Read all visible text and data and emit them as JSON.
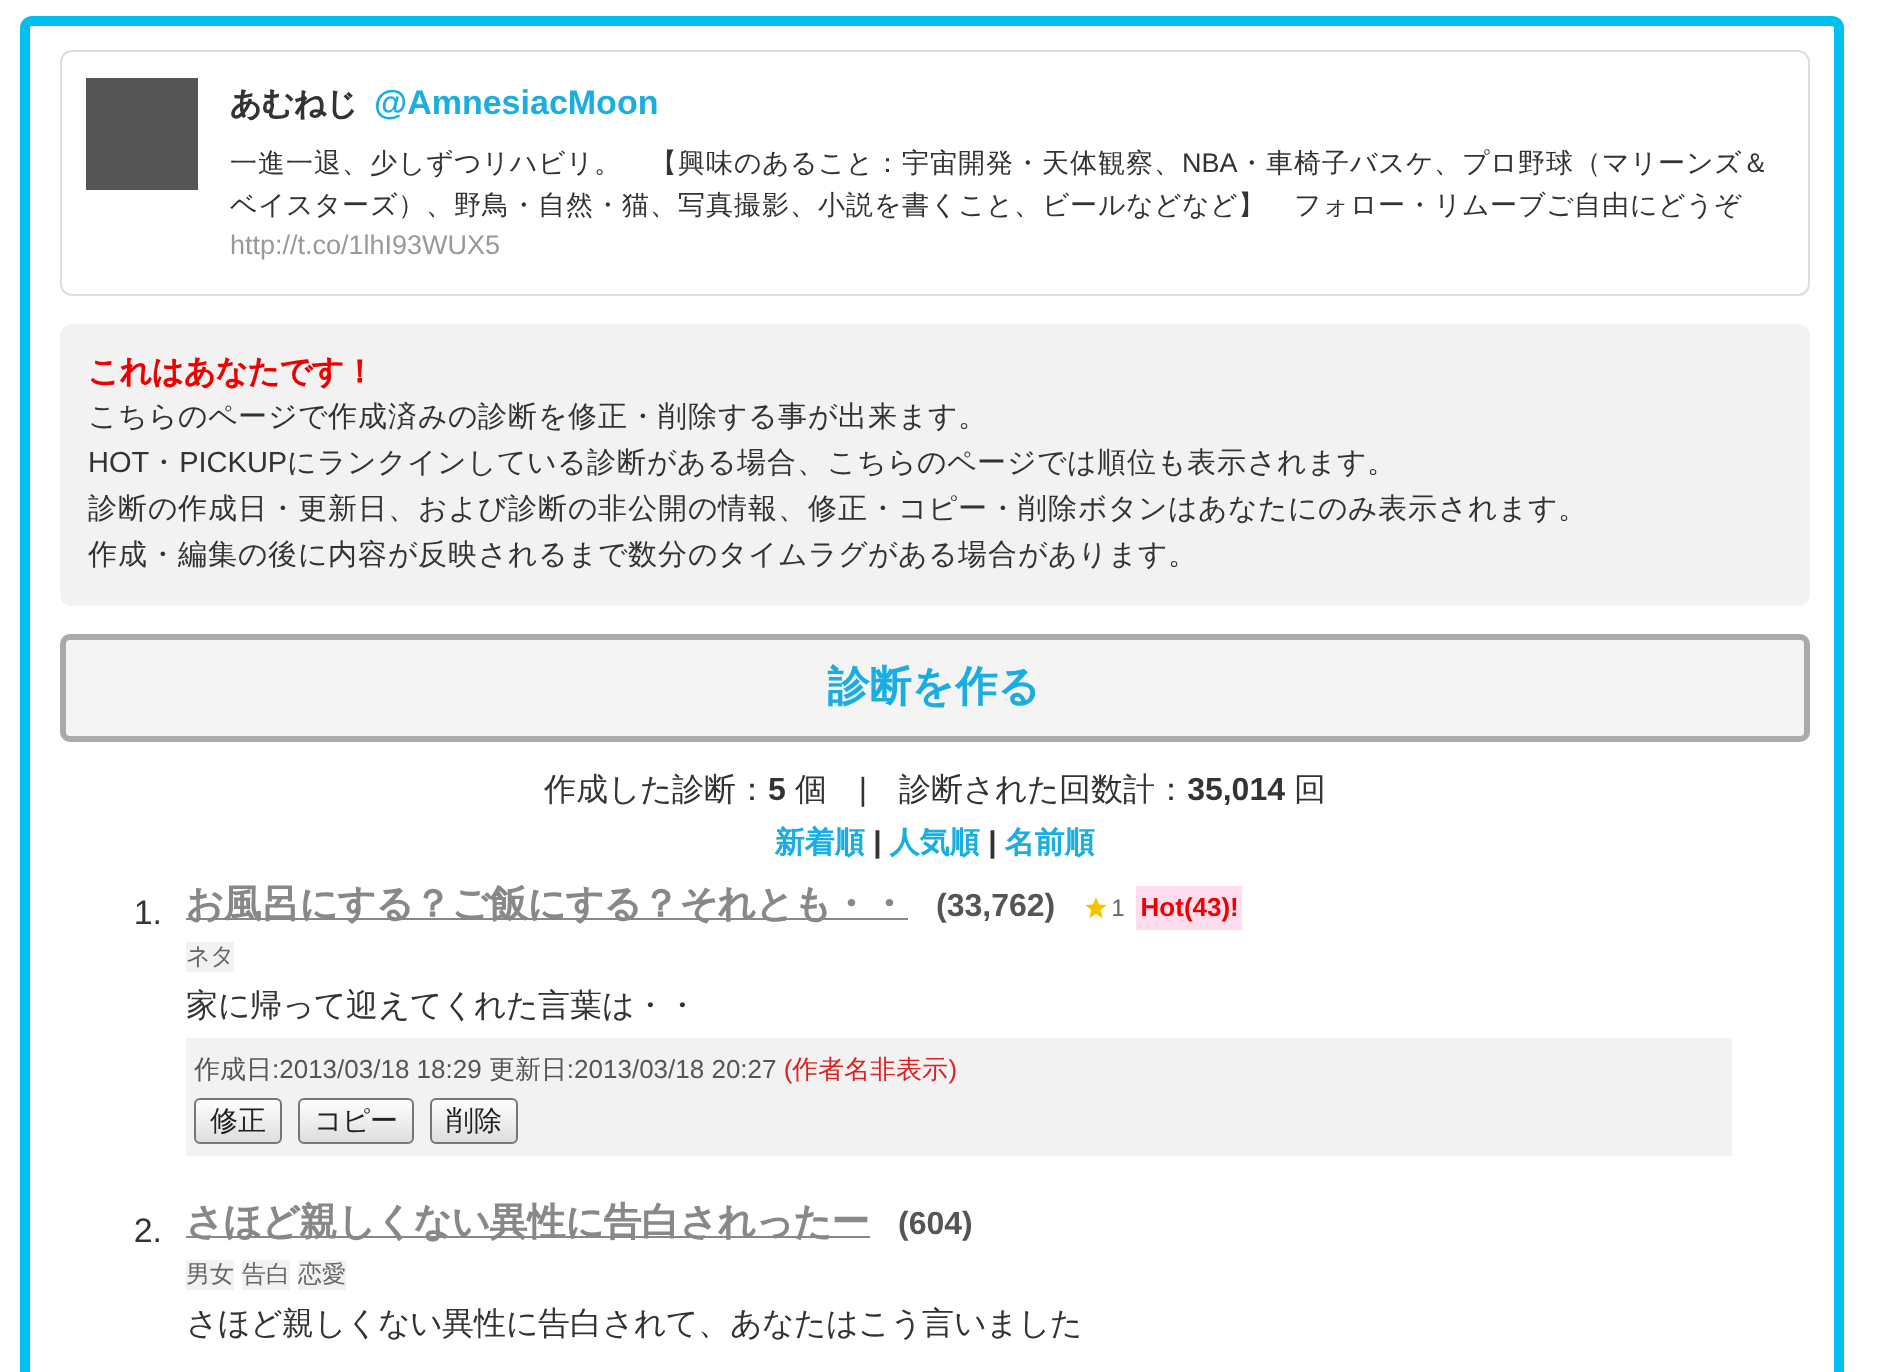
{
  "profile": {
    "name": "あむねじ",
    "handle": "@AmnesiacMoon",
    "bio": "一進一退、少しずつリハビリ。　【興味のあること：宇宙開発・天体観察、NBA・車椅子バスケ、プロ野球（マリーンズ＆ベイスターズ）、野鳥・自然・猫、写真撮影、小説を書くこと、ビールなどなど】　フォロー・リムーブご自由にどうぞ",
    "url": "http://t.co/1lhI93WUX5"
  },
  "notice": {
    "title": "これはあなたです！",
    "lines": [
      "こちらのページで作成済みの診断を修正・削除する事が出来ます。",
      "HOT・PICKUPにランクインしている診断がある場合、こちらのページでは順位も表示されます。",
      "診断の作成日・更新日、および診断の非公開の情報、修正・コピー・削除ボタンはあなたにのみ表示されます。",
      "作成・編集の後に内容が反映されるまで数分のタイムラグがある場合があります。"
    ]
  },
  "create_button": "診断を作る",
  "stats": "作成した診断：**5** 個　|　診断された回数計：**35,014** 回",
  "sort_links": [
    {
      "label": "新着順"
    },
    {
      "label": "人気順"
    },
    {
      "label": "名前順"
    }
  ],
  "sort_separator": "|",
  "items": [
    {
      "number": "1.",
      "title": "お風呂にする？ご飯にする？それとも・・",
      "count": "(33,762)",
      "favorites": "1",
      "hot": "Hot(43)!",
      "tags": [
        "ネタ"
      ],
      "description": "家に帰って迎えてくれた言葉は・・",
      "dates": "作成日:2013/03/18 18:29 更新日:2013/03/18 20:27",
      "author_note": "(作者名非表示)",
      "buttons": [
        "修正",
        "コピー",
        "削除"
      ]
    },
    {
      "number": "2.",
      "title": "さほど親しくない異性に告白されったー",
      "count": "(604)",
      "tags": [
        "男女",
        "告白",
        "恋愛"
      ],
      "description": "さほど親しくない異性に告白されて、あなたはこう言いました"
    }
  ]
}
